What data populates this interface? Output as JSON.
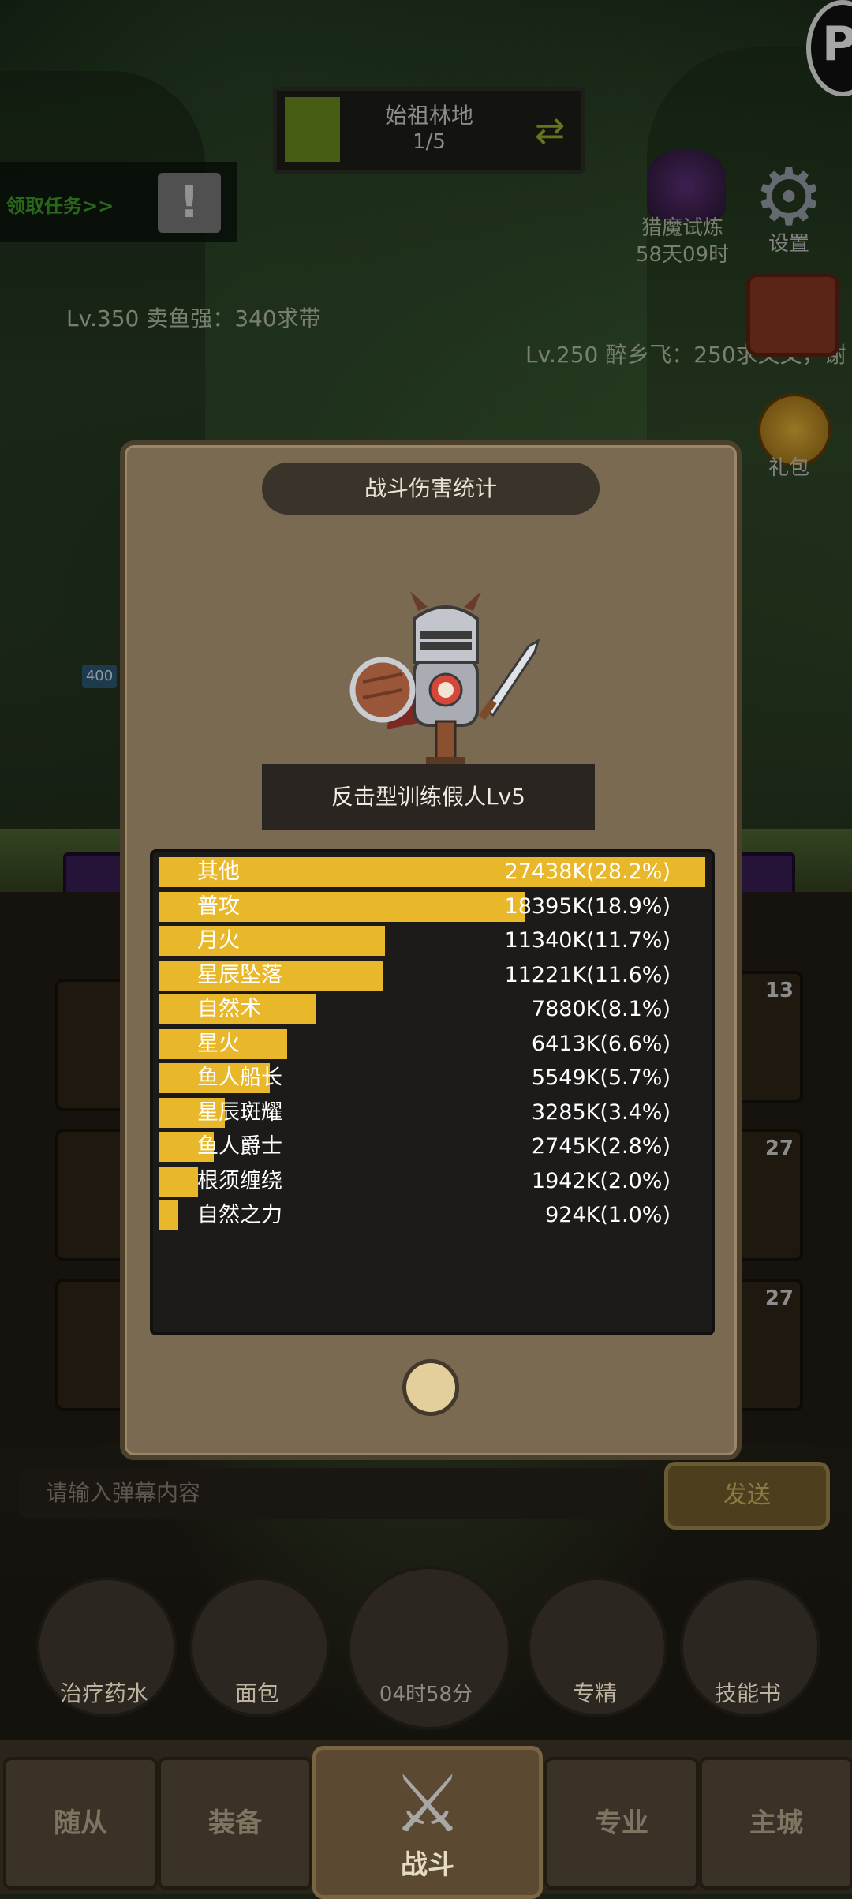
{
  "top_bar": {
    "map_name": "始祖林地",
    "map_progress": "1/5",
    "quest_link": "领取任务>>",
    "quest_icon_glyph": "!"
  },
  "players": {
    "player_a": "Lv.350 卖鱼强：340求带",
    "player_b": "Lv.250 醉乡飞：250求义父，谢"
  },
  "right_menu": {
    "hunt_title": "猎魔试炼",
    "hunt_time": "58天09时",
    "settings_label": "设置",
    "gift_label": "礼包"
  },
  "side_badge": "400",
  "cards": {
    "card1": "13",
    "card2": "27",
    "card3": "27"
  },
  "modal": {
    "title": "战斗伤害统计",
    "target": "反击型训练假人Lv5"
  },
  "chart_data": {
    "type": "bar",
    "orientation": "horizontal",
    "bar_color": "#e9b82a",
    "categories": [
      "其他",
      "普攻",
      "月火",
      "星辰坠落",
      "自然术",
      "星火",
      "鱼人船长",
      "星辰斑耀",
      "鱼人爵士",
      "根须缠绕",
      "自然之力"
    ],
    "values": [
      27438,
      18395,
      11340,
      11221,
      7880,
      6413,
      5549,
      3285,
      2745,
      1942,
      924
    ],
    "labels": [
      "27438K(28.2%)",
      "18395K(18.9%)",
      "11340K(11.7%)",
      "11221K(11.6%)",
      "7880K(8.1%)",
      "6413K(6.6%)",
      "5549K(5.7%)",
      "3285K(3.4%)",
      "2745K(2.8%)",
      "1942K(2.0%)",
      "924K(1.0%)"
    ]
  },
  "chat": {
    "placeholder": "请输入弹幕内容",
    "send_label": "发送"
  },
  "items": {
    "potion": "治疗药水",
    "bread": "面包",
    "chest_timer": "04时58分",
    "mastery": "专精",
    "skillbook": "技能书"
  },
  "nav": {
    "followers": "随从",
    "equipment": "装备",
    "battle": "战斗",
    "profession": "专业",
    "city": "主城"
  }
}
